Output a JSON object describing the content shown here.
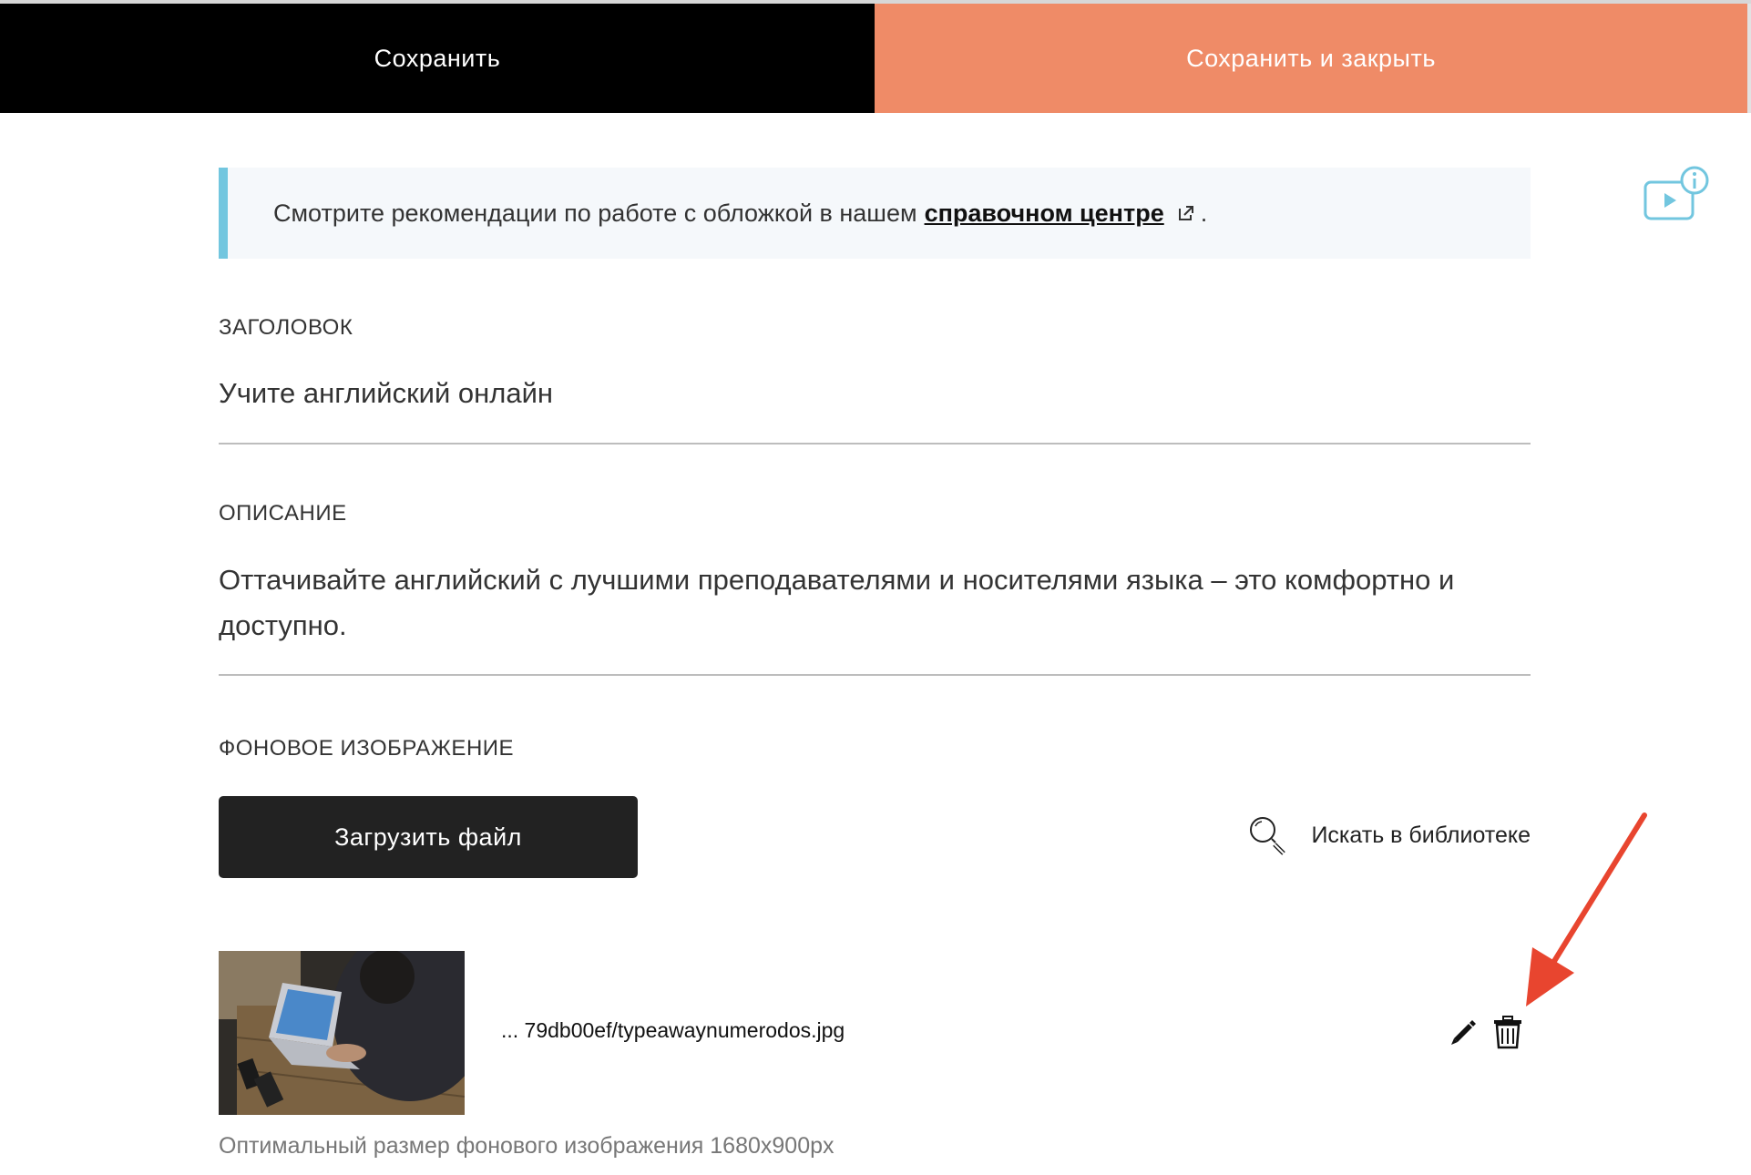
{
  "toolbar": {
    "save_label": "Сохранить",
    "save_close_label": "Сохранить и закрыть"
  },
  "info": {
    "text": "Смотрите рекомендации по работе с обложкой в нашем",
    "link_text": "справочном центре",
    "suffix": "."
  },
  "fields": {
    "title_label": "ЗАГОЛОВОК",
    "title_value": "Учите английский онлайн",
    "description_label": "ОПИСАНИЕ",
    "description_value": "Оттачивайте английский с лучшими преподавателями и носителями языка – это комфортно и доступно.",
    "background_label": "ФОНОВОЕ ИЗОБРАЖЕНИЕ"
  },
  "upload": {
    "button_label": "Загрузить файл",
    "library_label": "Искать в библиотеке"
  },
  "file": {
    "name": "... 79db00ef/typeawaynumerodos.jpg"
  },
  "hint": "Оптимальный размер фонового изображения 1680x900px",
  "colors": {
    "accent": "#ef8b67",
    "info_border": "#72c6df",
    "annotation_arrow": "#e8452f"
  },
  "icons": [
    "video-info-icon",
    "external-link-icon",
    "search-icon",
    "edit-icon",
    "trash-icon",
    "arrow-annotation-icon"
  ]
}
